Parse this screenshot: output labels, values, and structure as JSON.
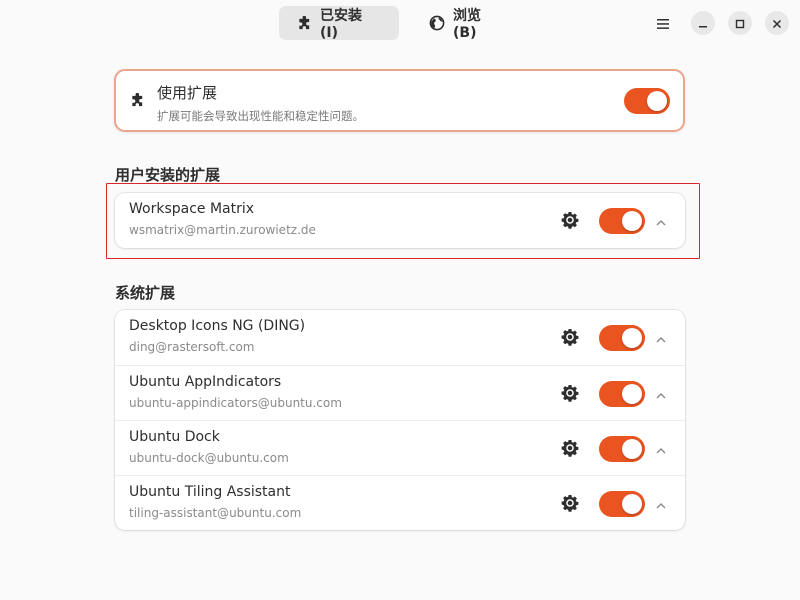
{
  "header": {
    "tabs": [
      {
        "label": "已安装 (I)",
        "icon": "puzzle-icon",
        "active": true
      },
      {
        "label": "浏览 (B)",
        "icon": "globe-icon",
        "active": false
      }
    ],
    "window_buttons": [
      "menu-icon",
      "minimize-icon",
      "maximize-icon",
      "close-icon"
    ]
  },
  "use_extensions": {
    "title": "使用扩展",
    "subtitle": "扩展可能会导致出现性能和稳定性问题。",
    "enabled": true
  },
  "user_section": {
    "title": "用户安装的扩展",
    "extensions": [
      {
        "name": "Workspace Matrix",
        "uuid": "wsmatrix@martin.zurowietz.de",
        "enabled": true
      }
    ]
  },
  "system_section": {
    "title": "系统扩展",
    "extensions": [
      {
        "name": "Desktop Icons NG (DING)",
        "uuid": "ding@rastersoft.com",
        "enabled": true
      },
      {
        "name": "Ubuntu AppIndicators",
        "uuid": "ubuntu-appindicators@ubuntu.com",
        "enabled": true
      },
      {
        "name": "Ubuntu Dock",
        "uuid": "ubuntu-dock@ubuntu.com",
        "enabled": true
      },
      {
        "name": "Ubuntu Tiling Assistant",
        "uuid": "tiling-assistant@ubuntu.com",
        "enabled": true
      }
    ]
  },
  "colors": {
    "accent": "#e95420",
    "highlight_border": "#d9262b"
  }
}
